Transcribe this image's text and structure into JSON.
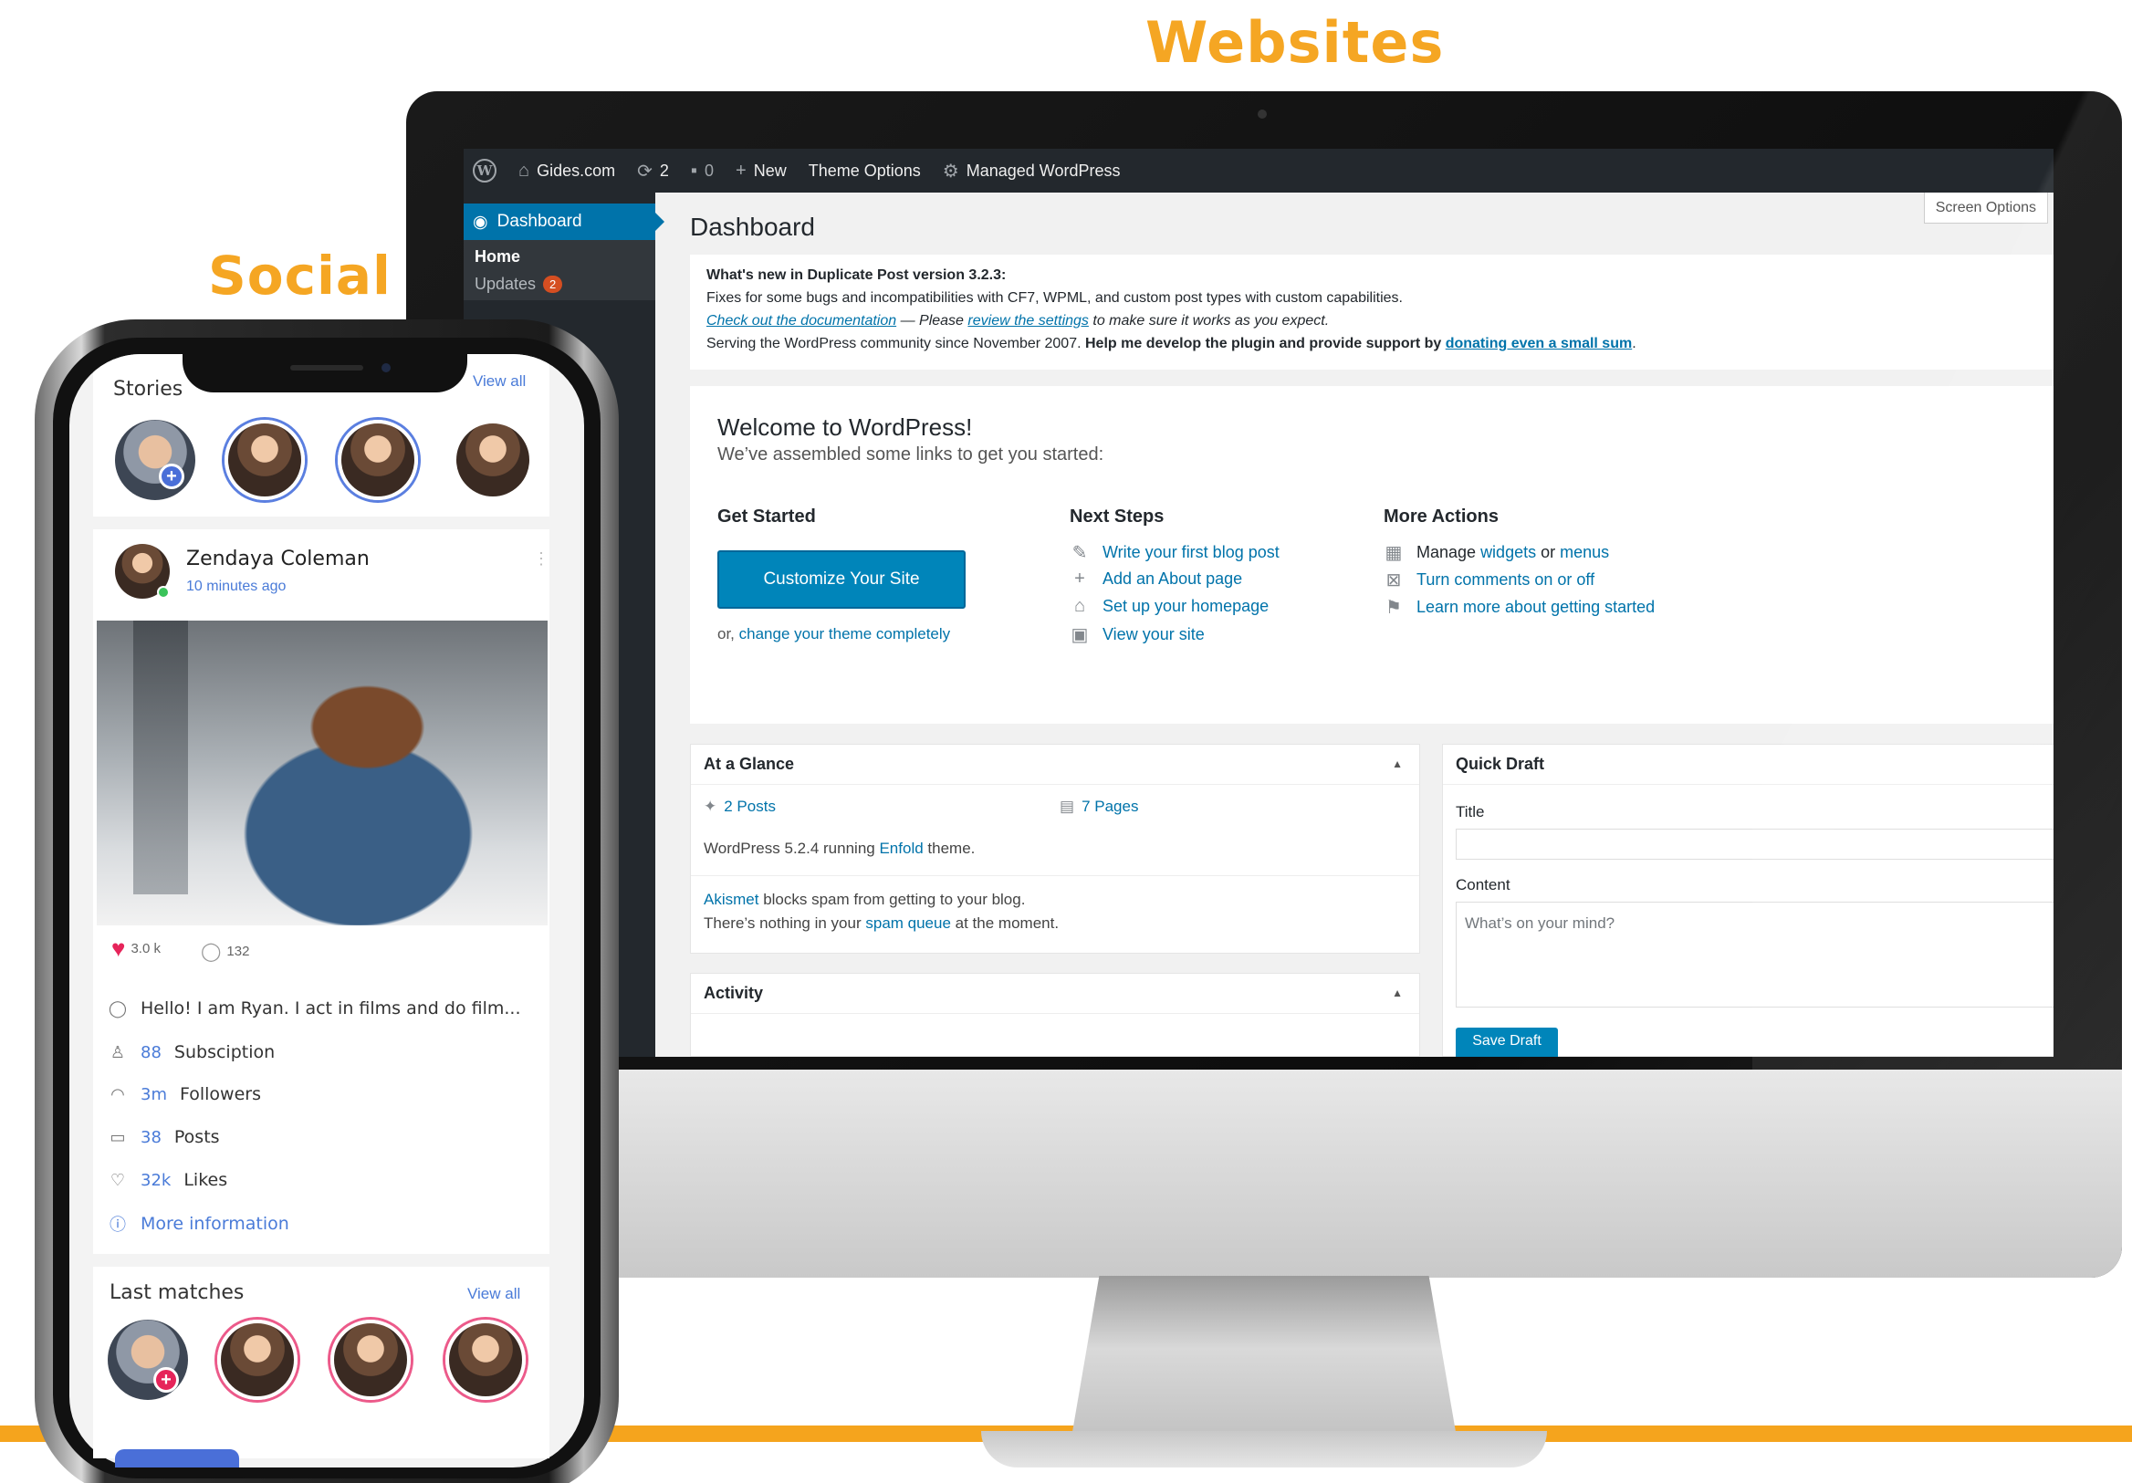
{
  "headings": {
    "websites": "Websites",
    "social": "Social"
  },
  "colors": {
    "accent_orange": "#f5a623",
    "wp_blue": "#0073aa",
    "admin_dark": "#23282d",
    "social_blue": "#4a7bd8",
    "like_red": "#e6245a"
  },
  "adminbar": {
    "site": "Gides.com",
    "updates_count": "2",
    "comments_count": "0",
    "new_label": "New",
    "theme_options": "Theme Options",
    "managed": "Managed WordPress"
  },
  "sidebar": {
    "dashboard": "Dashboard",
    "home": "Home",
    "updates": "Updates",
    "updates_badge": "2"
  },
  "dashboard": {
    "title": "Dashboard",
    "screen_options": "Screen Options",
    "notice": {
      "heading": "What's new in Duplicate Post version 3.2.3:",
      "line1": "Fixes for some bugs and incompatibilities with CF7, WPML, and custom post types with custom capabilities.",
      "doc_link": "Check out the documentation",
      "mid": " — Please ",
      "settings_link": "review the settings",
      "tail": " to make sure it works as you expect.",
      "serving": "Serving the WordPress community since November 2007. ",
      "help": "Help me develop the plugin and provide support by ",
      "donate_link": "donating even a small sum",
      "period": "."
    },
    "welcome": {
      "title": "Welcome to WordPress!",
      "subtitle": "We’ve assembled some links to get you started:",
      "get_started": "Get Started",
      "customize_btn": "Customize Your Site",
      "or_prefix": "or, ",
      "change_theme": "change your theme completely",
      "next_steps": "Next Steps",
      "steps": [
        "Write your first blog post",
        "Add an About page",
        "Set up your homepage",
        "View your site"
      ],
      "more_actions": "More Actions",
      "manage_prefix": "Manage ",
      "widgets": "widgets",
      "or_word": " or ",
      "menus": "menus",
      "turn_comments": "Turn comments on or off",
      "learn_more": "Learn more about getting started"
    },
    "glance": {
      "title": "At a Glance",
      "posts": "2 Posts",
      "pages": "7 Pages",
      "running_prefix": "WordPress 5.2.4 running ",
      "theme": "Enfold",
      "running_suffix": " theme.",
      "akismet": "Akismet",
      "akismet_rest": " blocks spam from getting to your blog.",
      "queue_prefix": "There’s nothing in your ",
      "spam_queue": "spam queue",
      "queue_suffix": " at the moment."
    },
    "activity": {
      "title": "Activity"
    },
    "quick_draft": {
      "title": "Quick Draft",
      "title_label": "Title",
      "content_label": "Content",
      "content_placeholder": "What’s on your mind?",
      "save_btn": "Save Draft"
    }
  },
  "phone": {
    "stories_title": "Stories",
    "view_all": "View all",
    "post": {
      "name": "Zendaya Coleman",
      "time": "10 minutes ago",
      "likes": "3.0 k",
      "comments": "132"
    },
    "bio": "Hello! I am Ryan. I act in films and do film...",
    "info": [
      {
        "num": "88",
        "label": "Subsciption"
      },
      {
        "num": "3m",
        "label": "Followers"
      },
      {
        "num": "38",
        "label": "Posts"
      },
      {
        "num": "32k",
        "label": "Likes"
      }
    ],
    "more_info": "More information",
    "last_matches": "Last matches",
    "view_all_2": "View all"
  }
}
